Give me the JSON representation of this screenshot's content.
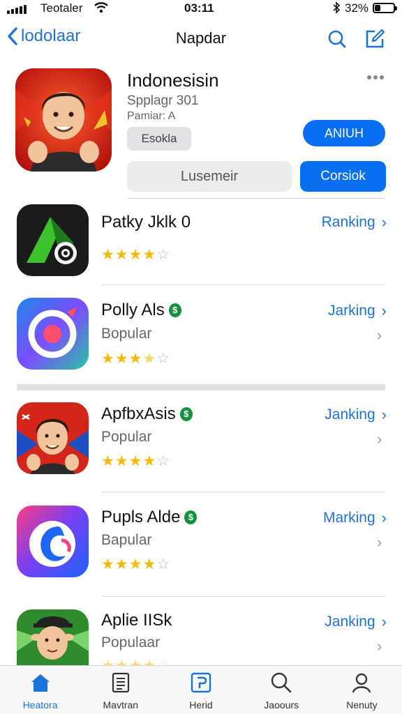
{
  "status_bar": {
    "carrier": "Teotaler",
    "time": "03:11",
    "battery": "32%",
    "battery_level": 0.32
  },
  "nav": {
    "back_label": "lodolaar",
    "title": "Napdar"
  },
  "featured": {
    "name": "Indonesisin",
    "subtitle": "Spplagr 301",
    "meta": "Pamiar: A",
    "tag": "Esokla",
    "get_label": "ANIUH",
    "secondary_label": "Lusemeir",
    "primary_label": "Corsiok"
  },
  "apps": [
    {
      "name": "Patky Jklk 0",
      "subtitle": "",
      "action": "Ranking",
      "rating": 4,
      "badge": ""
    },
    {
      "name": "Polly Als",
      "subtitle": "Bopular",
      "action": "Jarking",
      "rating": 3.5,
      "badge": "$"
    },
    {
      "name": "ApfbxAsis",
      "subtitle": "Popular",
      "action": "Janking",
      "rating": 4,
      "badge": "$"
    },
    {
      "name": "Pupls Alde",
      "subtitle": "Bapular",
      "action": "Marking",
      "rating": 4,
      "badge": "$"
    },
    {
      "name": "Aplie IISk",
      "subtitle": "Populaar",
      "action": "Janking",
      "rating": 4,
      "badge": ""
    }
  ],
  "tabs": [
    {
      "label": "Heatora",
      "icon": "home-icon",
      "active": true
    },
    {
      "label": "Mavtran",
      "icon": "news-icon",
      "active": false
    },
    {
      "label": "Herid",
      "icon": "apps-icon",
      "active": false
    },
    {
      "label": "Jaoours",
      "icon": "search-icon",
      "active": false
    },
    {
      "label": "Nenuty",
      "icon": "person-icon",
      "active": false
    }
  ],
  "colors": {
    "accent": "#0a6ef0",
    "link": "#1a73d9",
    "star": "#f4b90b"
  }
}
